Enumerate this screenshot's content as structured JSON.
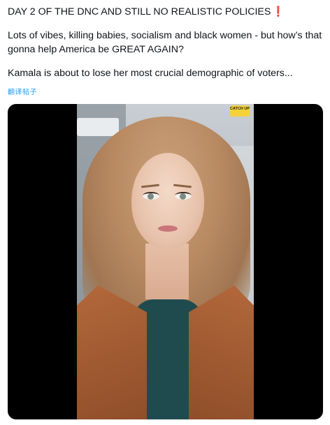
{
  "post": {
    "line1": "DAY 2 OF THE DNC AND STILL NO REALISTIC POLICIES",
    "line1_emoji": "❗",
    "line2": "Lots of vibes, killing babies, socialism and black women - but how’s that gonna help America be GREAT AGAIN?",
    "line3": "Kamala is about to lose her most crucial demographic of voters...",
    "translate_label": "翻译帖子"
  },
  "media": {
    "badge_text": "CATCH UP"
  },
  "colors": {
    "link": "#1d9bf0",
    "text": "#0f1419",
    "emoji": "#e0245e",
    "badge": "#f5d23a",
    "media_background": "#000000"
  }
}
